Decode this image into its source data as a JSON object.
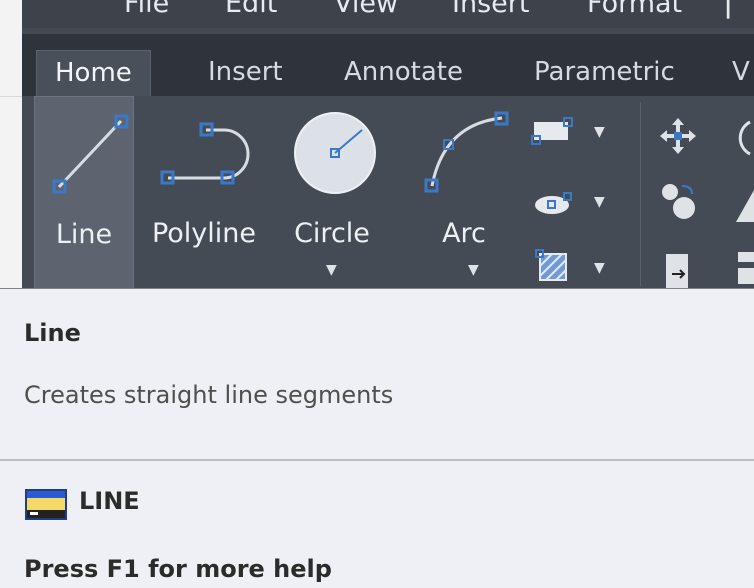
{
  "menubar": {
    "items": [
      "File",
      "Edit",
      "View",
      "Insert",
      "Format"
    ]
  },
  "ribbon": {
    "tabs": [
      {
        "label": "Home",
        "active": true
      },
      {
        "label": "Insert",
        "active": false
      },
      {
        "label": "Annotate",
        "active": false
      },
      {
        "label": "Parametric",
        "active": false
      },
      {
        "label": "V",
        "active": false
      }
    ],
    "draw_tools": [
      {
        "label": "Line",
        "icon": "line-icon"
      },
      {
        "label": "Polyline",
        "icon": "polyline-icon"
      },
      {
        "label": "Circle",
        "icon": "circle-icon"
      },
      {
        "label": "Arc",
        "icon": "arc-icon"
      }
    ]
  },
  "tooltip": {
    "title": "Line",
    "description": "Creates straight line segments",
    "command_name": "LINE",
    "help_text": "Press F1 for more help"
  },
  "colors": {
    "ribbon_bg": "#454b55",
    "tab_bg": "#2f333a",
    "tooltip_bg": "#eff0f5",
    "grip_blue": "#3a78c8"
  }
}
